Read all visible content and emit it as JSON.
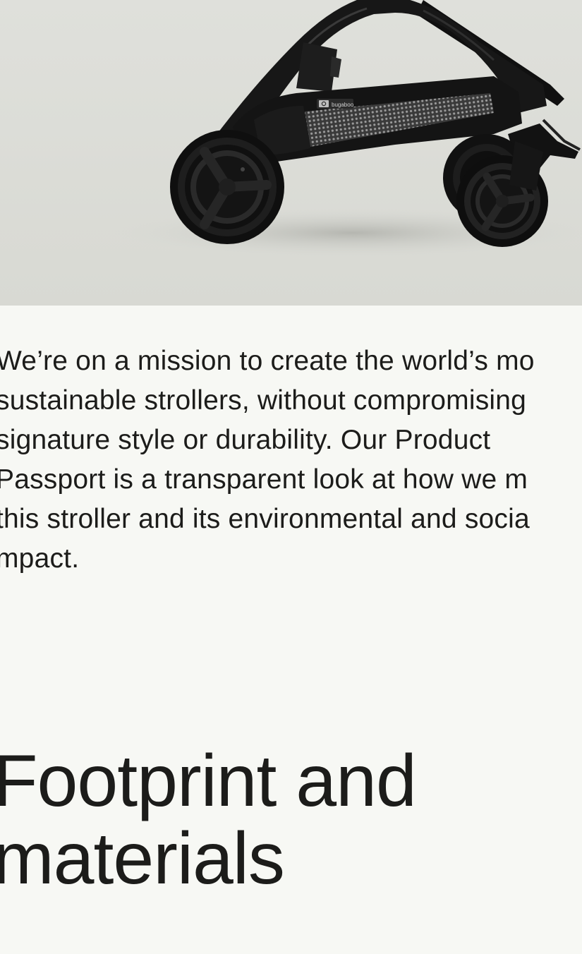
{
  "hero_image": {
    "alt": "Black folded stroller frame with mesh storage basket",
    "brand_tag": "bugaboo",
    "colors": {
      "background": "#dcddd8",
      "frame": "#161616",
      "mesh": "#6f6f6f"
    }
  },
  "mission": {
    "lines": [
      "We’re on a mission to create the world’s mo",
      "sustainable strollers, without compromising",
      "signature style or durability. Our Product",
      "Passport is a transparent look at how we m",
      "this stroller and its environmental and socia",
      "mpact."
    ]
  },
  "section": {
    "heading_lines": [
      "Footprint and",
      "materials"
    ]
  },
  "colors": {
    "page_background": "#f7f8f4",
    "text": "#1c1c1a"
  }
}
